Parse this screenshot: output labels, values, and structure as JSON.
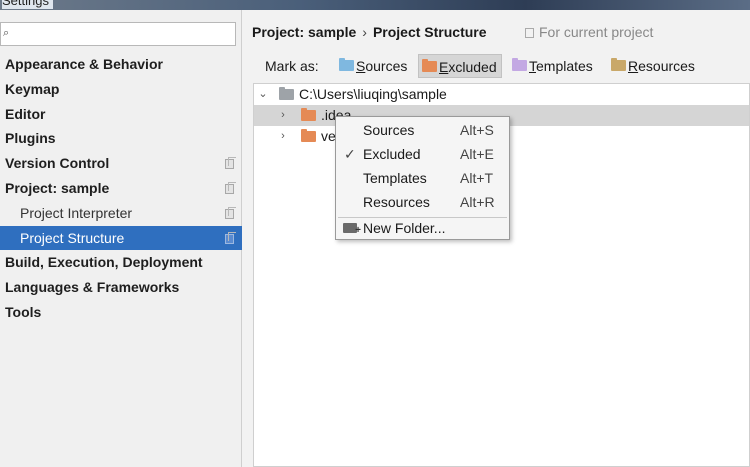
{
  "window": {
    "title": "Settings"
  },
  "search": {
    "value": "",
    "icon": "search-icon"
  },
  "sidebar": {
    "items": [
      {
        "label": "Appearance & Behavior"
      },
      {
        "label": "Keymap"
      },
      {
        "label": "Editor"
      },
      {
        "label": "Plugins"
      },
      {
        "label": "Version Control"
      },
      {
        "label": "Project: sample"
      },
      {
        "label": "Project Interpreter"
      },
      {
        "label": "Project Structure"
      },
      {
        "label": "Build, Execution, Deployment"
      },
      {
        "label": "Languages & Frameworks"
      },
      {
        "label": "Tools"
      }
    ]
  },
  "header": {
    "crumb_project": "Project: sample",
    "crumb_sep": "›",
    "crumb_page": "Project Structure",
    "for_current": "For current project"
  },
  "markbar": {
    "label": "Mark as:",
    "buttons": [
      {
        "mnemonic": "S",
        "rest": "ources",
        "color": "#7fb8e0"
      },
      {
        "mnemonic": "E",
        "rest": "xcluded",
        "color": "#e58a55"
      },
      {
        "mnemonic": "T",
        "rest": "emplates",
        "color": "#c3a8e3"
      },
      {
        "mnemonic": "R",
        "rest": "esources",
        "color": "#c9a869"
      }
    ]
  },
  "tree": {
    "root": "C:\\Users\\liuqing\\sample",
    "children": [
      {
        "label": ".idea"
      },
      {
        "label": "ve"
      }
    ],
    "arrow_expanded": "⌄",
    "arrow_collapsed": "›"
  },
  "context_menu": {
    "items": [
      {
        "label": "Sources",
        "shortcut": "Alt+S"
      },
      {
        "label": "Excluded",
        "shortcut": "Alt+E",
        "check": "✓"
      },
      {
        "label": "Templates",
        "shortcut": "Alt+T"
      },
      {
        "label": "Resources",
        "shortcut": "Alt+R"
      }
    ],
    "new_folder": "New Folder..."
  }
}
